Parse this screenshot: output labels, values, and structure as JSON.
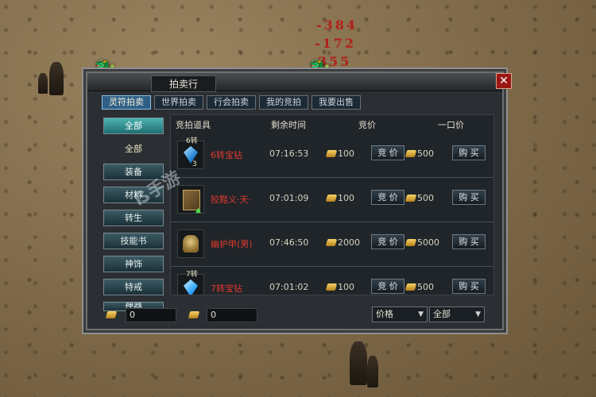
{
  "scene": {
    "damage_numbers": [
      "-384",
      "-172",
      "355"
    ],
    "watermark": "ẞ手游"
  },
  "window": {
    "title": "拍卖行",
    "close_label": "✕",
    "tabs": [
      {
        "label": "灵符拍卖",
        "active": true
      },
      {
        "label": "世界拍卖",
        "active": false
      },
      {
        "label": "行会拍卖",
        "active": false
      },
      {
        "label": "我的竞拍",
        "active": false
      },
      {
        "label": "我要出售",
        "active": false
      }
    ],
    "sidebar": [
      {
        "label": "全部",
        "style": "sel"
      },
      {
        "label": "全部",
        "style": "hdr"
      },
      {
        "label": "装备",
        "style": "normal"
      },
      {
        "label": "材料",
        "style": "normal"
      },
      {
        "label": "转生",
        "style": "normal"
      },
      {
        "label": "技能书",
        "style": "normal"
      },
      {
        "label": "神饰",
        "style": "normal"
      },
      {
        "label": "特戒",
        "style": "normal"
      },
      {
        "label": "神器",
        "style": "normal"
      }
    ],
    "columns": {
      "item": "竞拍道具",
      "time": "剩余时间",
      "bid": "竞价",
      "buyout": "一口价"
    },
    "rows": [
      {
        "badge_top": "6转",
        "badge_count": "3",
        "icon": "gem-icon",
        "name": "6转宝钻",
        "time": "07:16:53",
        "bid": "100",
        "bid_btn": "竞 价",
        "buyout": "500",
        "buy_btn": "购 买"
      },
      {
        "badge_top": "",
        "badge_count": "",
        "icon": "skill-book-icon",
        "name": "狡黠义·天·",
        "time": "07:01:09",
        "bid": "100",
        "bid_btn": "竞 价",
        "buyout": "500",
        "buy_btn": "购 买"
      },
      {
        "badge_top": "",
        "badge_count": "",
        "icon": "armor-icon",
        "name": "幽护甲(男)",
        "time": "07:46:50",
        "bid": "2000",
        "bid_btn": "竞 价",
        "buyout": "5000",
        "buy_btn": "购 买"
      },
      {
        "badge_top": "7转",
        "badge_count": "",
        "icon": "gem-icon",
        "name": "7转宝钻",
        "time": "07:01:02",
        "bid": "100",
        "bid_btn": "竞 价",
        "buyout": "500",
        "buy_btn": "购 买"
      }
    ],
    "footer": {
      "gold_value": "0",
      "ingot_value": "0",
      "sort_select": "价格",
      "filter_select": "全部"
    }
  },
  "colors": {
    "item_name": "#e23a2e",
    "tab_active": "#2f5f86",
    "sidebar_selected": "#4db3b0",
    "close_button": "#9a1612"
  }
}
